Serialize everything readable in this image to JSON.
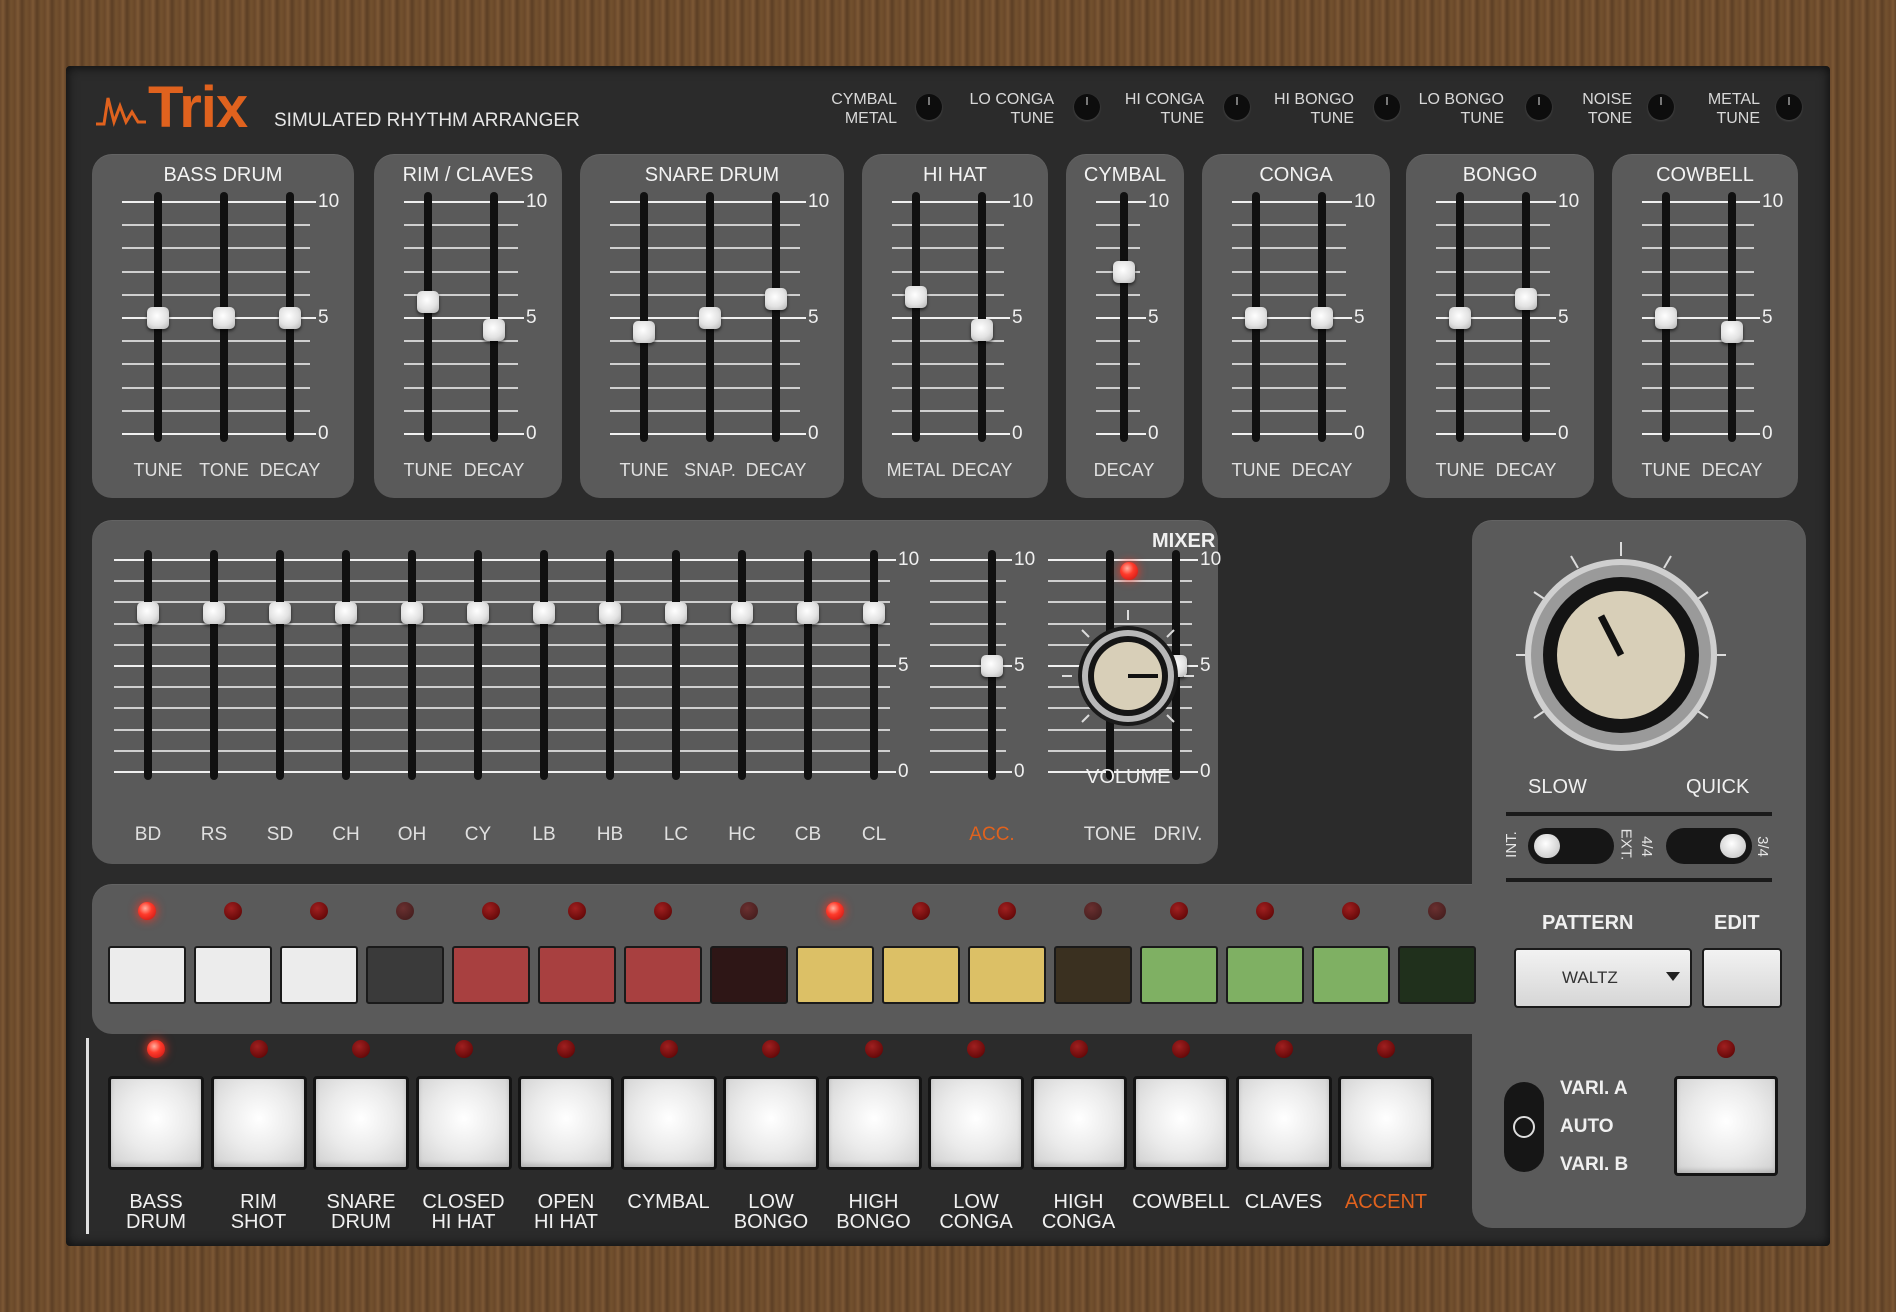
{
  "app": {
    "name": "Trix",
    "subtitle": "SIMULATED RHYTHM ARRANGER"
  },
  "header_knobs": [
    {
      "line1": "CYMBAL",
      "line2": "METAL"
    },
    {
      "line1": "LO CONGA",
      "line2": "TUNE"
    },
    {
      "line1": "HI CONGA",
      "line2": "TUNE"
    },
    {
      "line1": "HI BONGO",
      "line2": "TUNE"
    },
    {
      "line1": "LO BONGO",
      "line2": "TUNE"
    },
    {
      "line1": "NOISE",
      "line2": "TONE"
    },
    {
      "line1": "METAL",
      "line2": "TUNE"
    }
  ],
  "scale": {
    "max": "10",
    "mid": "5",
    "min": "0"
  },
  "instruments": [
    {
      "title": "BASS DRUM",
      "sliders": [
        {
          "label": "TUNE",
          "value": 5
        },
        {
          "label": "TONE",
          "value": 5
        },
        {
          "label": "DECAY",
          "value": 5
        }
      ]
    },
    {
      "title": "RIM / CLAVES",
      "sliders": [
        {
          "label": "TUNE",
          "value": 5.7
        },
        {
          "label": "DECAY",
          "value": 4.5
        }
      ]
    },
    {
      "title": "SNARE DRUM",
      "sliders": [
        {
          "label": "TUNE",
          "value": 4.4
        },
        {
          "label": "SNAP.",
          "value": 5
        },
        {
          "label": "DECAY",
          "value": 5.8
        }
      ]
    },
    {
      "title": "HI HAT",
      "sliders": [
        {
          "label": "METAL",
          "value": 5.9
        },
        {
          "label": "DECAY",
          "value": 4.5
        }
      ]
    },
    {
      "title": "CYMBAL",
      "sliders": [
        {
          "label": "DECAY",
          "value": 7
        }
      ]
    },
    {
      "title": "CONGA",
      "sliders": [
        {
          "label": "TUNE",
          "value": 5
        },
        {
          "label": "DECAY",
          "value": 5
        }
      ]
    },
    {
      "title": "BONGO",
      "sliders": [
        {
          "label": "TUNE",
          "value": 5
        },
        {
          "label": "DECAY",
          "value": 5.8
        }
      ]
    },
    {
      "title": "COWBELL",
      "sliders": [
        {
          "label": "TUNE",
          "value": 5
        },
        {
          "label": "DECAY",
          "value": 4.4
        }
      ]
    }
  ],
  "mixer": {
    "title": "MIXER",
    "channels": [
      {
        "label": "BD",
        "value": 7.5
      },
      {
        "label": "RS",
        "value": 7.5
      },
      {
        "label": "SD",
        "value": 7.5
      },
      {
        "label": "CH",
        "value": 7.5
      },
      {
        "label": "OH",
        "value": 7.5
      },
      {
        "label": "CY",
        "value": 7.5
      },
      {
        "label": "LB",
        "value": 7.5
      },
      {
        "label": "HB",
        "value": 7.5
      },
      {
        "label": "LC",
        "value": 7.5
      },
      {
        "label": "HC",
        "value": 7.5
      },
      {
        "label": "CB",
        "value": 7.5
      },
      {
        "label": "CL",
        "value": 7.5
      }
    ],
    "accent": {
      "label": "ACC.",
      "value": 5
    },
    "tone": {
      "label": "TONE",
      "value": 5
    },
    "drive": {
      "label": "DRIV.",
      "value": 5
    },
    "volume_label": "VOLUME"
  },
  "tempo": {
    "slow_label": "SLOW",
    "quick_label": "QUICK"
  },
  "switches": {
    "int_label": "INT.",
    "ext_label": "EXT.",
    "sig_a_label": "4/4",
    "sig_b_label": "3/4"
  },
  "pattern": {
    "label": "PATTERN",
    "edit_label": "EDIT",
    "selected": "WALTZ"
  },
  "steps": {
    "leds": [
      "on",
      "off",
      "off",
      "dim",
      "off",
      "off",
      "off",
      "dim",
      "on",
      "off",
      "off",
      "dim",
      "off",
      "off",
      "off",
      "dim"
    ],
    "colors": [
      "#ececec",
      "#ececec",
      "#ececec",
      "#3a3a3a",
      "#a84040",
      "#a84040",
      "#a84040",
      "#2e1616",
      "#dcc066",
      "#dcc066",
      "#dcc066",
      "#3a3020",
      "#7fb063",
      "#7fb063",
      "#7fb063",
      "#20301c"
    ]
  },
  "pads": {
    "leds": [
      "on",
      "off",
      "off",
      "off",
      "off",
      "off",
      "off",
      "off",
      "off",
      "off",
      "off",
      "off",
      "off"
    ],
    "labels": [
      {
        "l1": "BASS",
        "l2": "DRUM"
      },
      {
        "l1": "RIM",
        "l2": "SHOT"
      },
      {
        "l1": "SNARE",
        "l2": "DRUM"
      },
      {
        "l1": "CLOSED",
        "l2": "HI HAT"
      },
      {
        "l1": "OPEN",
        "l2": "HI HAT"
      },
      {
        "l1": "CYMBAL",
        "l2": ""
      },
      {
        "l1": "LOW",
        "l2": "BONGO"
      },
      {
        "l1": "HIGH",
        "l2": "BONGO"
      },
      {
        "l1": "LOW",
        "l2": "CONGA"
      },
      {
        "l1": "HIGH",
        "l2": "CONGA"
      },
      {
        "l1": "COWBELL",
        "l2": ""
      },
      {
        "l1": "CLAVES",
        "l2": ""
      },
      {
        "l1": "ACCENT",
        "l2": ""
      }
    ]
  },
  "variation": {
    "a": "VARI. A",
    "auto": "AUTO",
    "b": "VARI. B"
  },
  "colors": {
    "accent": "#e0621e",
    "panel": "#2b2b2b",
    "card": "#5a5a5a"
  }
}
